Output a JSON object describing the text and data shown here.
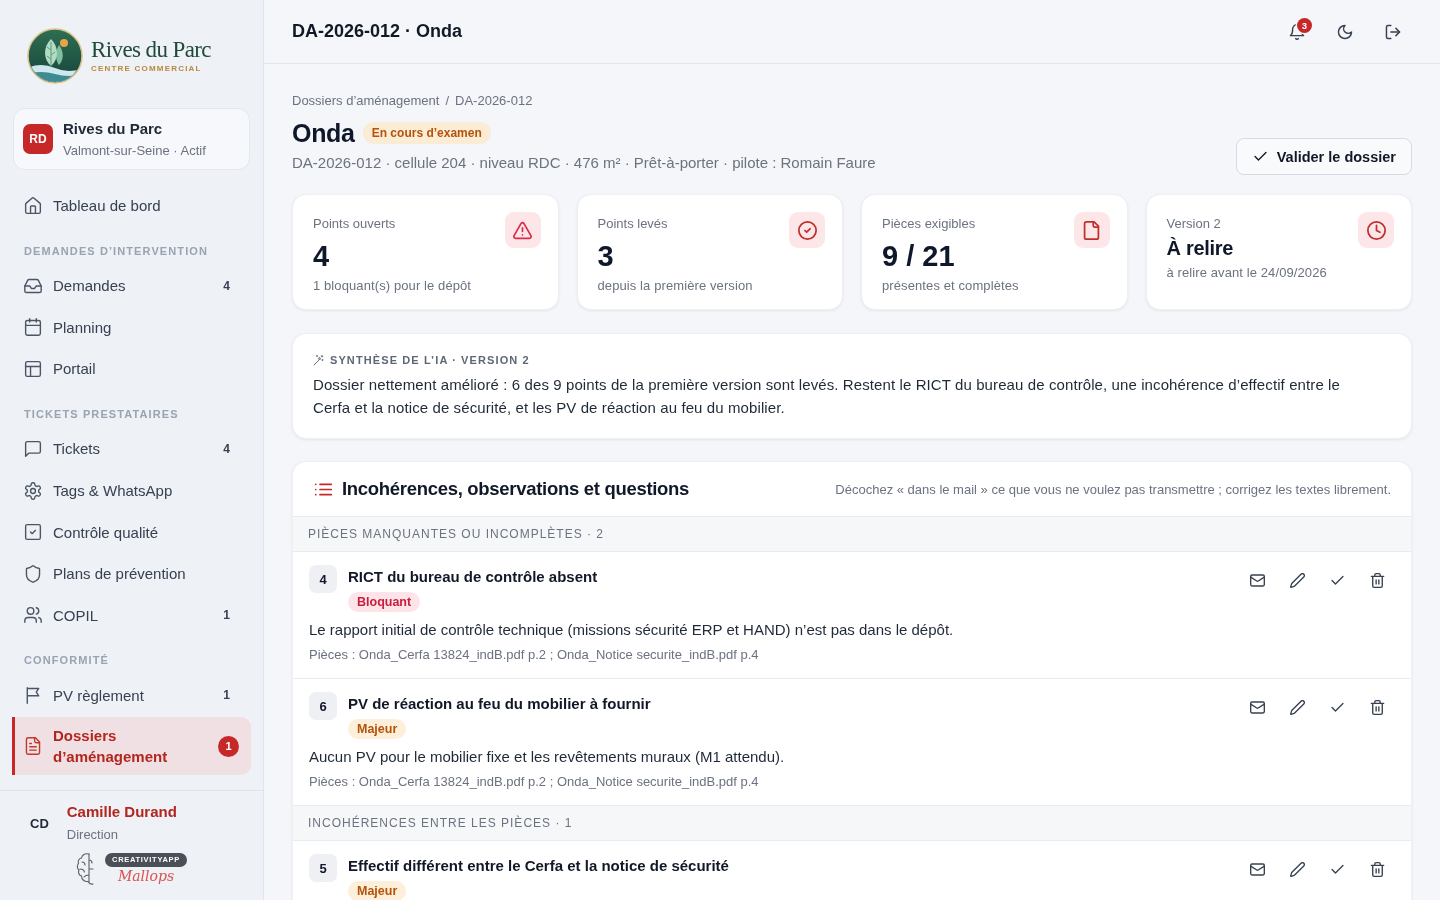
{
  "sidebar": {
    "logo": {
      "title": "Rives du Parc",
      "tagline": "CENTRE COMMERCIAL"
    },
    "site": {
      "initials": "RD",
      "name": "Rives du Parc",
      "subtitle": "Valmont-sur-Seine · Actif"
    },
    "nav": [
      {
        "items": [
          {
            "label": "Tableau de bord",
            "selected": false
          }
        ]
      },
      {
        "title": "DEMANDES D’INTERVENTION",
        "items": [
          {
            "label": "Demandes",
            "count": "4",
            "selected": false
          },
          {
            "label": "Planning",
            "selected": false
          },
          {
            "label": "Portail",
            "selected": false
          }
        ]
      },
      {
        "title": "TICKETS PRESTATAIRES",
        "items": [
          {
            "label": "Tickets",
            "count": "4",
            "selected": false
          },
          {
            "label": "Tags & WhatsApp",
            "selected": false
          },
          {
            "label": "Contrôle qualité",
            "selected": false
          },
          {
            "label": "Plans de prévention",
            "selected": false
          },
          {
            "label": "COPIL",
            "count": "1",
            "selected": false
          }
        ]
      },
      {
        "title": "CONFORMITÉ",
        "items": [
          {
            "label": "PV règlement",
            "count": "1",
            "selected": false
          },
          {
            "label": "Dossiers d’aménagement",
            "count": "1",
            "selected": true
          }
        ]
      }
    ],
    "user": {
      "initials": "CD",
      "name": "Camille Durand",
      "role": "Direction"
    },
    "credit": {
      "label": "CREATIVITYAPP",
      "script": "Mallops"
    }
  },
  "topbar": {
    "title": "DA-2026-012 · Onda",
    "notification_count": "3"
  },
  "page": {
    "breadcrumb": {
      "items": [
        "Dossiers d’aménagement",
        "DA-2026-012"
      ],
      "separator": "/"
    },
    "title": "Onda",
    "status": "En cours d’examen",
    "meta": "DA-2026-012 · cellule 204 · niveau RDC · 476 m² · Prêt-à-porter · pilote : Romain Faure",
    "action": "Valider le dossier"
  },
  "stats": [
    {
      "kind": "count",
      "label": "Points ouverts",
      "value": "4",
      "note": "1 bloquant(s) pour le dépôt"
    },
    {
      "kind": "count",
      "label": "Points levés",
      "value": "3",
      "note": "depuis la première version"
    },
    {
      "kind": "count",
      "label": "Pièces exigibles",
      "value": "9 / 21",
      "note": "présentes et complètes"
    },
    {
      "kind": "status",
      "label": "Version 2",
      "value": "À relire",
      "note": "à relire avant le 24/09/2026"
    }
  ],
  "ai_summary": {
    "label": "SYNTHÈSE DE L’IA · VERSION 2",
    "text": "Dossier nettement amélioré : 6 des 9 points de la première version sont levés. Restent le RICT du bureau de contrôle, une incohérence d’effectif entre le Cerfa et la notice de sécurité, et les PV de réaction au feu du mobilier."
  },
  "issues": {
    "title": "Incohérences, observations et questions",
    "hint": "Décochez « dans le mail » ce que vous ne voulez pas transmettre ; corrigez les textes librement.",
    "groups": [
      {
        "title": "PIÈCES MANQUANTES OU INCOMPLÈTES · 2",
        "items": [
          {
            "number": "4",
            "title": "RICT du bureau de contrôle absent",
            "severity": {
              "kind": "blocking",
              "label": "Bloquant"
            },
            "description": "Le rapport initial de contrôle technique (missions sécurité ERP et HAND) n’est pas dans le dépôt.",
            "files": "Pièces : Onda_Cerfa 13824_indB.pdf p.2 ; Onda_Notice securite_indB.pdf p.4"
          },
          {
            "number": "6",
            "title": "PV de réaction au feu du mobilier à fournir",
            "severity": {
              "kind": "major",
              "label": "Majeur"
            },
            "description": "Aucun PV pour le mobilier fixe et les revêtements muraux (M1 attendu).",
            "files": "Pièces : Onda_Cerfa 13824_indB.pdf p.2 ; Onda_Notice securite_indB.pdf p.4"
          }
        ]
      },
      {
        "title": "INCOHÉRENCES ENTRE LES PIÈCES · 1",
        "items": [
          {
            "number": "5",
            "title": "Effectif différent entre le Cerfa et la notice de sécurité",
            "severity": {
              "kind": "major",
              "label": "Majeur"
            }
          }
        ]
      }
    ]
  }
}
